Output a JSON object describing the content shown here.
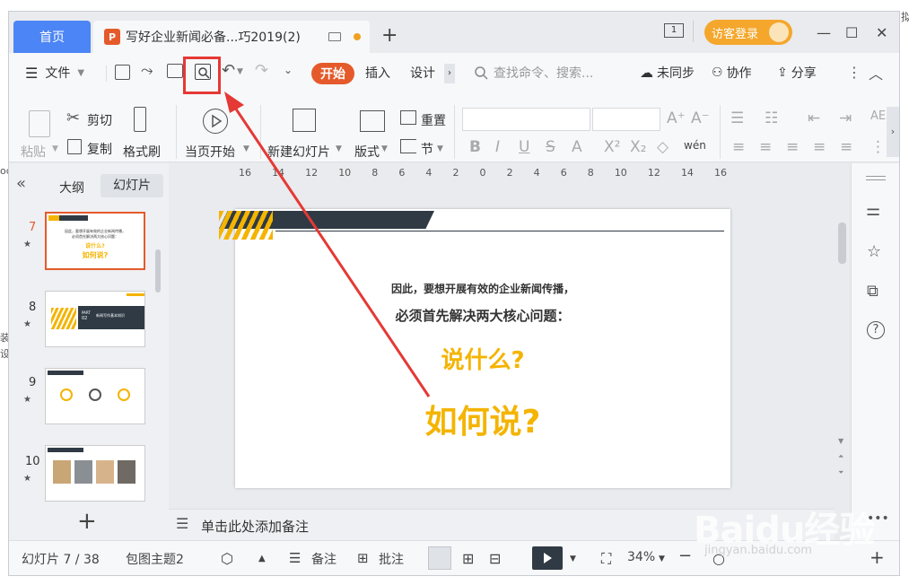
{
  "titlebar": {
    "home_tab": "首页",
    "doc_badge": "P",
    "doc_tab": "写好企业新闻必备...巧2019(2)",
    "login": "访客登录",
    "page_badge": "1"
  },
  "menu": {
    "file": "文件",
    "tabs": [
      "开始",
      "插入",
      "设计"
    ],
    "search_placeholder": "查找命令、搜索...",
    "sync": "未同步",
    "collab": "协作",
    "share": "分享"
  },
  "ribbon": {
    "paste": "粘贴",
    "cut": "剪切",
    "copy": "复制",
    "format_painter": "格式刷",
    "play_current": "当页开始",
    "new_slide": "新建幻灯片",
    "layout": "版式",
    "reset": "重置",
    "section": "节",
    "underline_style": "wén"
  },
  "panel": {
    "outline_tab": "大纲",
    "slides_tab": "幻灯片",
    "collapse": "«",
    "slide_numbers": [
      "7",
      "8",
      "9",
      "10"
    ],
    "add": "+"
  },
  "thumbs": {
    "t7_line1": "因此，要想开展有效的企业新闻传播，",
    "t7_line2": "必须首先解决两大核心问题：",
    "t7_q1": "说什么?",
    "t7_q2": "如何说?",
    "t8_part": "PART",
    "t8_num": "02",
    "t8_title": "新闻写作基本知识"
  },
  "ruler": {
    "ticks": [
      "16",
      "14",
      "12",
      "10",
      "8",
      "6",
      "4",
      "2",
      "0",
      "2",
      "4",
      "6",
      "8",
      "10",
      "12",
      "14",
      "16"
    ]
  },
  "slide": {
    "line1": "因此，要想开展有效的企业新闻传播，",
    "line2": "必须首先解决两大核心问题：",
    "q1": "说什么?",
    "q2": "如何说?"
  },
  "notes": {
    "placeholder": "单击此处添加备注"
  },
  "status": {
    "slide_counter": "幻灯片 7 / 38",
    "theme": "包图主题2",
    "notes": "备注",
    "comments": "批注",
    "zoom": "34%"
  },
  "watermark": {
    "brand": "Baidu经验",
    "url": "jingyan.baidu.com"
  },
  "edge_text": {
    "top_right": "拟",
    "left1": "oc",
    "left2": "装",
    "left3": "设"
  },
  "colors": {
    "accent_orange": "#e55a2b",
    "home_tab_blue": "#4c85f5",
    "slide_yellow": "#f4b400",
    "dark_bar": "#2f3a45",
    "annotation_red": "#e53935"
  }
}
